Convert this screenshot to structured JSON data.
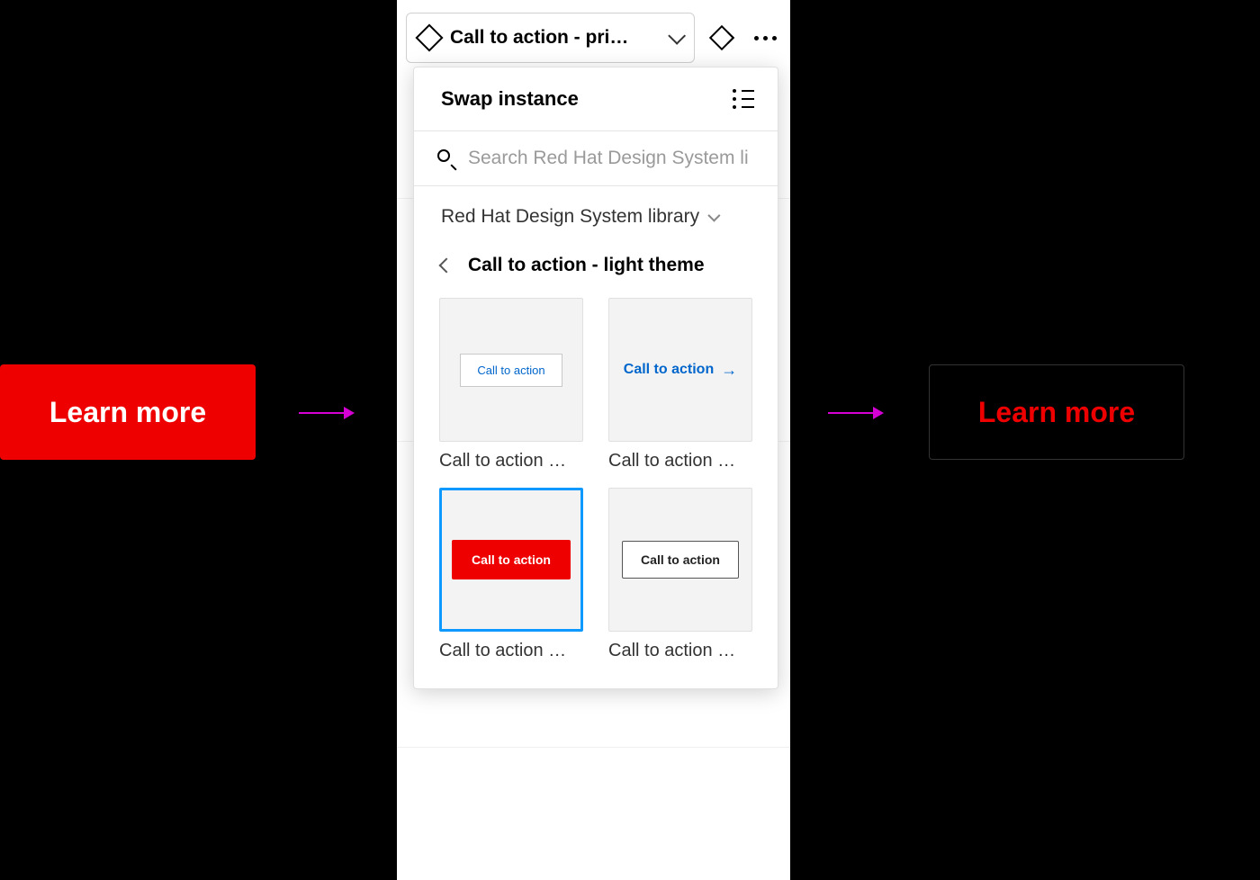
{
  "left_button": {
    "label": "Learn more"
  },
  "right_button": {
    "label": "Learn more"
  },
  "topbar": {
    "instance_name": "Call to action - pri…"
  },
  "swap": {
    "title": "Swap instance",
    "search_placeholder": "Search Red Hat Design System li",
    "library_name": "Red Hat Design System library",
    "category": "Call to action - light theme",
    "cards": [
      {
        "label": "Call to action …",
        "variant": "box",
        "text": "Call to action",
        "selected": false
      },
      {
        "label": "Call to action …",
        "variant": "link",
        "text": "Call to action",
        "selected": false
      },
      {
        "label": "Call to action …",
        "variant": "red",
        "text": "Call to action",
        "selected": true
      },
      {
        "label": "Call to action …",
        "variant": "outline",
        "text": "Call to action",
        "selected": false
      }
    ]
  },
  "colors": {
    "red": "#ee0000",
    "blue_link": "#0066cc",
    "selection": "#0d99ff",
    "arrow": "#d400d4"
  }
}
